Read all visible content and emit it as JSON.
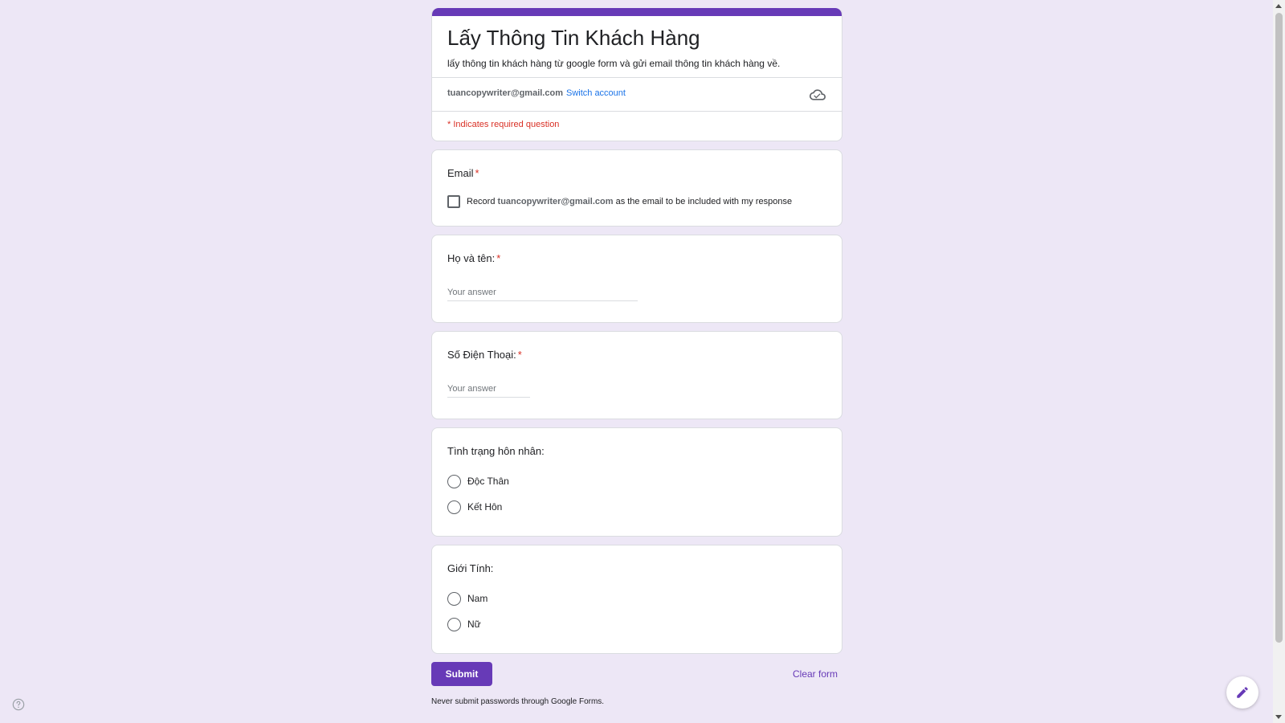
{
  "form": {
    "title": "Lấy Thông Tin Khách Hàng",
    "description": "lấy thông tin khách hàng từ google form và gửi email thông tin khách hàng về.",
    "account_email": "tuancopywriter@gmail.com",
    "switch_account": "Switch account",
    "required_note": "* Indicates required question"
  },
  "questions": {
    "email": {
      "title": "Email",
      "required_mark": "*",
      "record_prefix": "Record ",
      "record_email": "tuancopywriter@gmail.com",
      "record_suffix": " as the email to be included with my response"
    },
    "name": {
      "title": "Họ và tên:",
      "required_mark": "*",
      "placeholder": "Your answer"
    },
    "phone": {
      "title": "Số Điện Thoại:",
      "required_mark": "*",
      "placeholder": "Your answer"
    },
    "marital": {
      "title": "Tình trạng hôn nhân:",
      "options": [
        "Độc Thân",
        "Kết Hôn"
      ]
    },
    "gender": {
      "title": "Giới Tính:",
      "options": [
        "Nam",
        "Nữ"
      ]
    }
  },
  "actions": {
    "submit": "Submit",
    "clear": "Clear form"
  },
  "footer": {
    "note": "Never submit passwords through Google Forms."
  },
  "colors": {
    "accent": "#673ab7",
    "background": "#ede7f6",
    "required": "#d93025",
    "link": "#1a73e8"
  },
  "icons": {
    "cloud": "cloud-done-icon",
    "help": "help-icon",
    "edit": "pencil-icon"
  }
}
